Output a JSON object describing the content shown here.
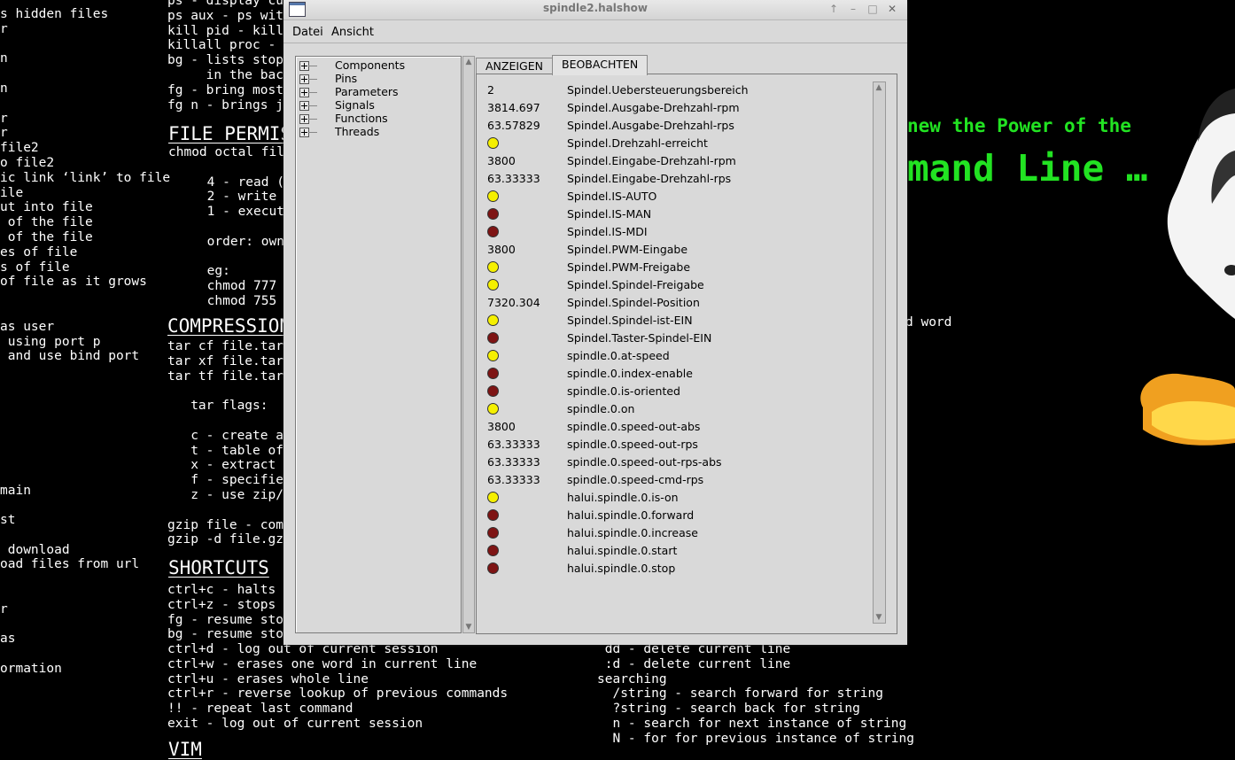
{
  "wallpaper": {
    "col1": "s hidden files\nr\n\nn\n\nn\n\nr\nr\nfile2\no file2\nic link ‘link’ to file\nile\nut into file\n of the file\n of the file\nes of file\ns of file\nof file as it grows\n\n\nas user\n using port p\n and use bind port\n\n\n\n\n\n\n\n\nmain\n\nst\n\n download\noad files from url\n\n\nr\n\nas\n\normation",
    "col2a": "ps - display cur\nps aux - ps with\nkill pid - kill\nkillall proc - k\nbg - lists stopp\n     in the back\nfg - bring most\nfg n - brings jo",
    "heading_file_perms": "FILE PERMIS",
    "col2b": "chmod octal file\n\n     4 - read (r\n     2 - write (\n     1 - execute\n\n     order: owne\n\n     eg:\n     chmod 777 -\n     chmod 755 -",
    "heading_compression": "COMPRESSION",
    "col2c": "tar cf file.tar\ntar xf file.tar\ntar tf file.tar\n\n   tar flags:\n\n   c - create ar\n   t - table of\n   x - extract\n   f - specifies\n   z - use zip/g\n\ngzip file - comp\ngzip -d file.gz",
    "heading_shortcuts": "SHORTCUTS",
    "col2d": "ctrl+c - halts c\nctrl+z - stops c\nfg - resume stop\nbg - resume stop",
    "col2e": "ctrl+d - log out of current session\nctrl+w - erases one word in current line\nctrl+u - erases whole line\nctrl+r - reverse lookup of previous commands\n!! - repeat last command\nexit - log out of current session",
    "heading_vim": "VIM",
    "col3": " dd - delete current line\n :d - delete current line\nsearching\n  /string - search forward for string\n  ?string - search back for string\n  n - search for next instance of string\n  N - for for previous instance of string",
    "right_word": "d word",
    "green1": "new the Power of the",
    "green2": "mand Line …"
  },
  "window": {
    "title": "spindle2.halshow",
    "btn_up": "↑",
    "btn_min": "–",
    "btn_max": "□",
    "btn_close": "✕"
  },
  "menu": {
    "file": "Datei",
    "view": "Ansicht"
  },
  "tree": [
    "Components",
    "Pins",
    "Parameters",
    "Signals",
    "Functions",
    "Threads"
  ],
  "tabs": {
    "show": "ANZEIGEN",
    "watch": "BEOBACHTEN"
  },
  "watch": [
    {
      "type": "value",
      "value": "2",
      "name": "Spindel.Uebersteuerungsbereich"
    },
    {
      "type": "value",
      "value": "3814.697",
      "name": "Spindel.Ausgabe-Drehzahl-rpm"
    },
    {
      "type": "value",
      "value": "63.57829",
      "name": "Spindel.Ausgabe-Drehzahl-rps"
    },
    {
      "type": "bit",
      "state": "on",
      "name": "Spindel.Drehzahl-erreicht"
    },
    {
      "type": "value",
      "value": "3800",
      "name": "Spindel.Eingabe-Drehzahl-rpm"
    },
    {
      "type": "value",
      "value": "63.33333",
      "name": "Spindel.Eingabe-Drehzahl-rps"
    },
    {
      "type": "bit",
      "state": "on",
      "name": "Spindel.IS-AUTO"
    },
    {
      "type": "bit",
      "state": "off",
      "name": "Spindel.IS-MAN"
    },
    {
      "type": "bit",
      "state": "off",
      "name": "Spindel.IS-MDI"
    },
    {
      "type": "value",
      "value": "3800",
      "name": "Spindel.PWM-Eingabe"
    },
    {
      "type": "bit",
      "state": "on",
      "name": "Spindel.PWM-Freigabe"
    },
    {
      "type": "bit",
      "state": "on",
      "name": "Spindel.Spindel-Freigabe"
    },
    {
      "type": "value",
      "value": "7320.304",
      "name": "Spindel.Spindel-Position"
    },
    {
      "type": "bit",
      "state": "on",
      "name": "Spindel.Spindel-ist-EIN"
    },
    {
      "type": "bit",
      "state": "off",
      "name": "Spindel.Taster-Spindel-EIN"
    },
    {
      "type": "bit",
      "state": "on",
      "name": "spindle.0.at-speed"
    },
    {
      "type": "bit",
      "state": "off",
      "name": "spindle.0.index-enable"
    },
    {
      "type": "bit",
      "state": "off",
      "name": "spindle.0.is-oriented"
    },
    {
      "type": "bit",
      "state": "on",
      "name": "spindle.0.on"
    },
    {
      "type": "value",
      "value": "3800",
      "name": "spindle.0.speed-out-abs"
    },
    {
      "type": "value",
      "value": "63.33333",
      "name": "spindle.0.speed-out-rps"
    },
    {
      "type": "value",
      "value": "63.33333",
      "name": "spindle.0.speed-out-rps-abs"
    },
    {
      "type": "value",
      "value": "63.33333",
      "name": "spindle.0.speed-cmd-rps"
    },
    {
      "type": "bit",
      "state": "on",
      "name": "halui.spindle.0.is-on"
    },
    {
      "type": "bit",
      "state": "off",
      "name": "halui.spindle.0.forward"
    },
    {
      "type": "bit",
      "state": "off",
      "name": "halui.spindle.0.increase"
    },
    {
      "type": "bit",
      "state": "off",
      "name": "halui.spindle.0.start"
    },
    {
      "type": "bit",
      "state": "off",
      "name": "halui.spindle.0.stop"
    }
  ],
  "colors": {
    "led_on": "#f5f000",
    "led_off": "#7e1414",
    "terminal_green": "#22e322"
  }
}
